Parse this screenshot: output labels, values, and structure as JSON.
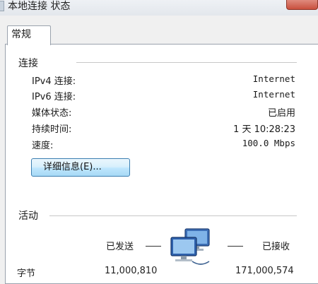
{
  "window": {
    "title": "本地连接 状态"
  },
  "tabs": [
    {
      "label": "常规"
    }
  ],
  "connection": {
    "group_title": "连接",
    "rows": [
      {
        "label": "IPv4 连接:",
        "value": "Internet"
      },
      {
        "label": "IPv6 连接:",
        "value": "Internet"
      },
      {
        "label": "媒体状态:",
        "value": "已启用"
      },
      {
        "label": "持续时间:",
        "value": "1 天 10:28:23"
      },
      {
        "label": "速度:",
        "value": "100.0 Mbps"
      }
    ],
    "details_button": "详细信息(E)..."
  },
  "activity": {
    "group_title": "活动",
    "sent_label": "已发送",
    "received_label": "已接收",
    "bytes_label": "字节",
    "sent_value": "11,000,810",
    "received_value": "171,000,574"
  },
  "colors": {
    "close_button": "#c9503e",
    "button_border": "#3c7fb1",
    "window_bg": "#f0f0f0"
  },
  "icons": {
    "title": "network-connection-icon",
    "activity": "network-computers-icon"
  }
}
